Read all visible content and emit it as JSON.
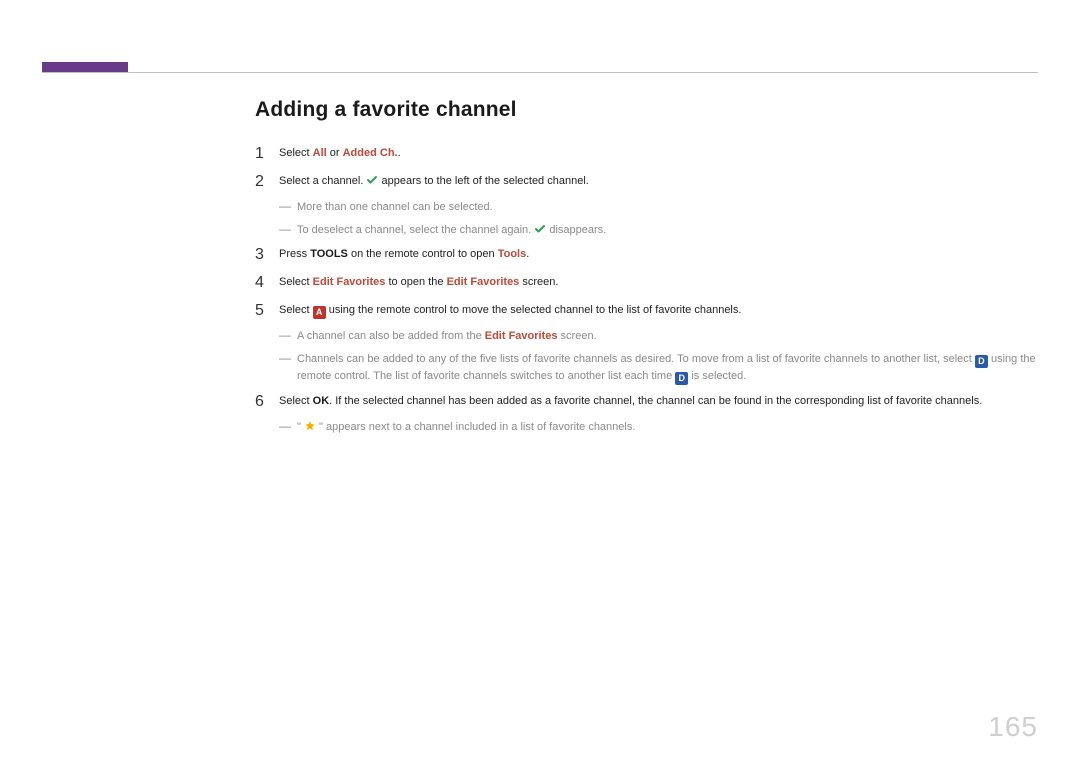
{
  "heading": "Adding a favorite channel",
  "pageNumber": "165",
  "steps": {
    "s1": {
      "num": "1",
      "t1": "Select ",
      "all": "All",
      "or": " or ",
      "added": "Added Ch.",
      "end": "."
    },
    "s2": {
      "num": "2",
      "t1": "Select a channel. ",
      "t2": " appears to the left of the selected channel.",
      "h1": "More than one channel can be selected.",
      "h2a": "To deselect a channel, select the channel again. ",
      "h2b": " disappears."
    },
    "s3": {
      "num": "3",
      "t1": "Press ",
      "tools_b": "TOOLS",
      "t2": " on the remote control to open ",
      "tools_e": "Tools",
      "end": "."
    },
    "s4": {
      "num": "4",
      "t1": "Select ",
      "ef1": "Edit Favorites",
      "t2": " to open the ",
      "ef2": "Edit Favorites",
      "t3": " screen."
    },
    "s5": {
      "num": "5",
      "t1": "Select ",
      "badgeA": "A",
      "t2": " using the remote control to move the selected channel to the list of favorite channels.",
      "h1a": "A channel can also be added from the ",
      "h1ef": "Edit Favorites",
      "h1b": " screen.",
      "h2a": "Channels can be added to any of the five lists of favorite channels as desired. To move from a list of favorite channels to another list, select ",
      "badgeD1": "D",
      "h2b": " using the remote control. The list of favorite channels switches to another list each time ",
      "badgeD2": "D",
      "h2c": " is selected."
    },
    "s6": {
      "num": "6",
      "t1": "Select ",
      "ok": "OK",
      "t2": ". If the selected channel has been added as a favorite channel, the channel can be found in the corresponding list of favorite channels.",
      "h1a": "\" ",
      "h1b": " \" appears next to a channel included in a list of favorite channels."
    }
  }
}
